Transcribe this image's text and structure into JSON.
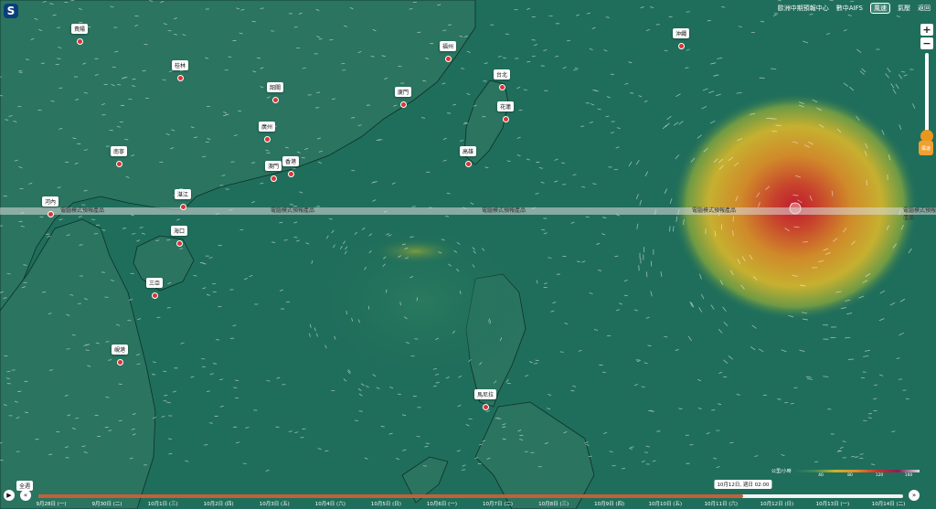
{
  "header": {
    "agency": "歐洲中期預報中心",
    "model": "數中AIFS",
    "layer_active": "風速",
    "layer_other": "氣壓",
    "back": "返回"
  },
  "logo": "S",
  "zoom": {
    "in": "+",
    "out": "−"
  },
  "layer_button": "風速",
  "watermark_text": "電腦模式預報產品",
  "cities": [
    {
      "name": "貴陽",
      "id": "guiyang"
    },
    {
      "name": "桂林",
      "id": "guilin"
    },
    {
      "name": "韶關",
      "id": "shaoguan"
    },
    {
      "name": "福州",
      "id": "fuzhou"
    },
    {
      "name": "廈門",
      "id": "xiamen"
    },
    {
      "name": "台北",
      "id": "taipei"
    },
    {
      "name": "花蓮",
      "id": "hualien"
    },
    {
      "name": "高雄",
      "id": "kaohsiung"
    },
    {
      "name": "廣州",
      "id": "guangzhou"
    },
    {
      "name": "南寧",
      "id": "nanning"
    },
    {
      "name": "澳門",
      "id": "macau"
    },
    {
      "name": "香港",
      "id": "hongkong"
    },
    {
      "name": "湛江",
      "id": "zhanjiang"
    },
    {
      "name": "河內",
      "id": "hanoi"
    },
    {
      "name": "海口",
      "id": "haikou"
    },
    {
      "name": "三亞",
      "id": "sanya"
    },
    {
      "name": "峴港",
      "id": "danang"
    },
    {
      "name": "馬尼拉",
      "id": "manila"
    },
    {
      "name": "沖繩",
      "id": "okinawa"
    }
  ],
  "timeline": {
    "all_label": "全週",
    "play_icon": "play-icon",
    "prev_icon": "rewind-icon",
    "next_icon": "forward-icon",
    "current_tooltip": "10月12日, 週日 02:00",
    "progress": 0.815,
    "ticks": [
      "9月28日 (一)",
      "9月30日 (二)",
      "10月1日 (三)",
      "10月2日 (四)",
      "10月3日 (五)",
      "10月4日 (六)",
      "10月5日 (日)",
      "10月6日 (一)",
      "10月7日 (二)",
      "10月8日 (三)",
      "10月9日 (四)",
      "10月10日 (五)",
      "10月11日 (六)",
      "10月12日 (日)",
      "10月13日 (一)",
      "10月14日 (二)"
    ]
  },
  "legend": {
    "unit": "公里/小時",
    "ticks": [
      "40",
      "80",
      "120",
      "160"
    ]
  },
  "colors": {
    "sea": "#1f6e5b",
    "storm_core": "#b8202e",
    "storm_outer": "#d9b030",
    "timeline_fill": "#c2603a"
  }
}
